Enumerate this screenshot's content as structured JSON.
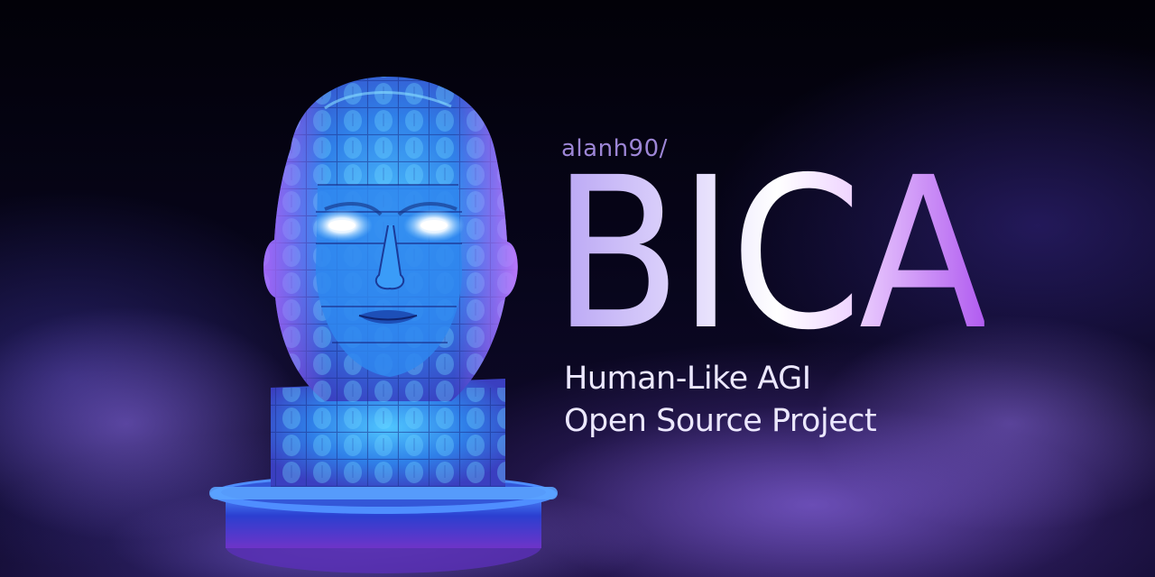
{
  "banner": {
    "owner": "alanh90/",
    "title": "BICA",
    "tagline_line1": "Human-Like AGI",
    "tagline_line2": "Open Source Project"
  },
  "illustration": {
    "subject": "head-sculpture-icon",
    "accent_colors": {
      "cyan": "#3fb8ff",
      "blue": "#2a58e0",
      "violet": "#8a4de0",
      "mist": "#6a4ccc"
    }
  }
}
